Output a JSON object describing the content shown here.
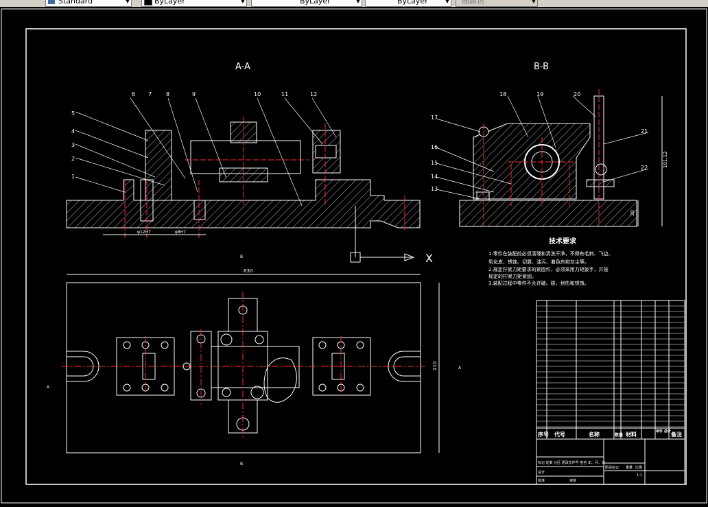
{
  "toolbar": {
    "text_style": "Standard",
    "layer1": "ByLayer",
    "layer2": "ByLayer",
    "lineweight": "ByLayer",
    "plotstyle": "随颜色"
  },
  "drawing": {
    "section_aa": "A-A",
    "section_bb": "B-B",
    "tech_title": "技术要求",
    "tech_lines": [
      "1.零件在装配前必须清理和清洗干净，不得有毛刺、飞边、",
      "氧化皮、锈蚀、切屑、油污、着色剂和灰尘等。",
      "2.规定拧紧力矩要求的紧固件，必须采用力矩扳手，并按",
      "规定的拧紧力矩紧固。",
      "3.装配过程中零件不允许磕、碰、划伤和锈蚀。"
    ],
    "balloons_aa": [
      "6",
      "7",
      "8",
      "9",
      "10",
      "11",
      "12",
      "5",
      "4",
      "3",
      "2",
      "1"
    ],
    "balloons_bb": [
      "18",
      "19",
      "20",
      "17",
      "21",
      "16",
      "15",
      "14",
      "22",
      "13"
    ],
    "dim_630": "630",
    "dim_210": "210",
    "dim_101": "101.12",
    "dim_30": "30",
    "dim_h7": "φ12H7",
    "dim_h7b": "φ8H7",
    "view_b_top": "B",
    "view_b_bottom": "B",
    "view_a_left": "A",
    "view_a_right": "A",
    "axis_x": "X",
    "bom_headers": [
      "序号",
      "代号",
      "名称",
      "数量",
      "材料",
      "单件 总计 重量",
      "备注"
    ],
    "bom_header_weight": "单件 总计",
    "title_block": {
      "row1": "标记 处数 分区 更改文件号 签名 年、月、日",
      "design": "设计",
      "check": "审核",
      "process": "工艺",
      "approve": "批准",
      "stage": "阶段标记",
      "weight": "重量",
      "scale": "比例",
      "scale_val": "1:1"
    }
  },
  "colors": {
    "line": "#ffffff",
    "center": "#ff2a2a",
    "hatch": "#ffffff",
    "dim": "#ffffff"
  }
}
